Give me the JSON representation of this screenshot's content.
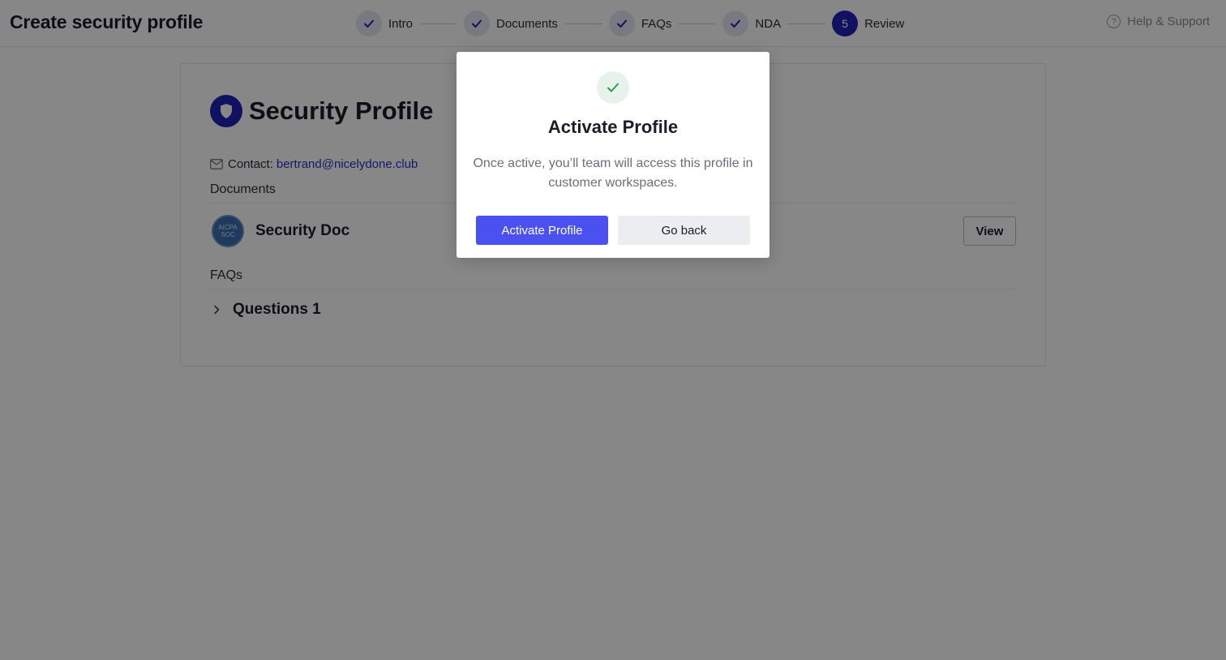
{
  "header": {
    "title": "Create security profile",
    "help_label": "Help & Support",
    "help_icon": "?"
  },
  "stepper": {
    "steps": [
      {
        "label": "Intro",
        "state": "done"
      },
      {
        "label": "Documents",
        "state": "done"
      },
      {
        "label": "FAQs",
        "state": "done"
      },
      {
        "label": "NDA",
        "state": "done"
      },
      {
        "label": "Review",
        "state": "active",
        "number": "5"
      }
    ]
  },
  "profile": {
    "title": "Security Profile",
    "contact_label": "Contact:",
    "contact_email": "bertrand@nicelydone.club",
    "documents_label": "Documents",
    "document": {
      "name": "Security Doc",
      "badge_line1": "AICPA",
      "badge_line2": "SOC",
      "view_label": "View"
    },
    "faqs_label": "FAQs",
    "faq_item": "Questions 1"
  },
  "modal": {
    "title": "Activate Profile",
    "message": "Once active, you’ll team will access this profile in customer workspaces.",
    "primary_label": "Activate Profile",
    "secondary_label": "Go back"
  },
  "colors": {
    "accent": "#1f21b5",
    "primary_button": "#4a51f0",
    "link": "#2b2fc9",
    "success": "#2e9b4f"
  }
}
